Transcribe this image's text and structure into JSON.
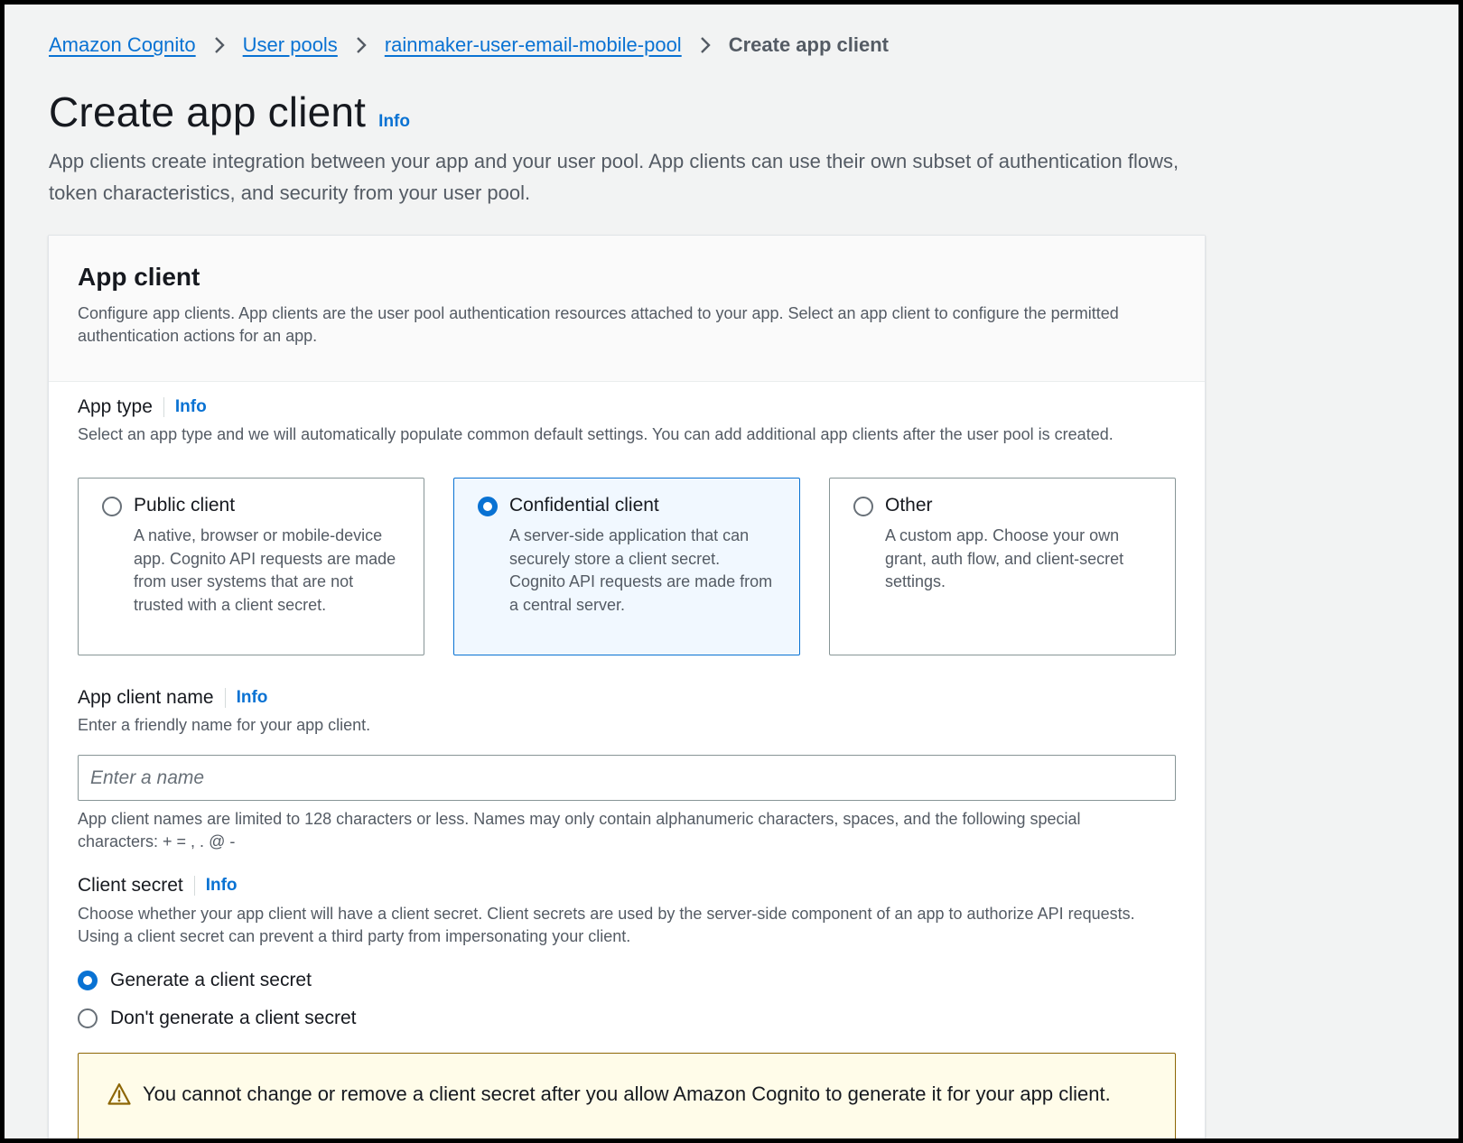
{
  "breadcrumb": {
    "items": [
      "Amazon Cognito",
      "User pools",
      "rainmaker-user-email-mobile-pool"
    ],
    "current": "Create app client"
  },
  "header": {
    "title": "Create app client",
    "info": "Info",
    "description": "App clients create integration between your app and your user pool. App clients can use their own subset of authentication flows, token characteristics, and security from your user pool."
  },
  "container": {
    "title": "App client",
    "description": "Configure app clients. App clients are the user pool authentication resources attached to your app. Select an app client to configure the permitted authentication actions for an app."
  },
  "app_type": {
    "label": "App type",
    "info": "Info",
    "description": "Select an app type and we will automatically populate common default settings. You can add additional app clients after the user pool is created.",
    "selected": "Confidential client",
    "options": [
      {
        "title": "Public client",
        "description": "A native, browser or mobile-device app. Cognito API requests are made from user systems that are not trusted with a client secret."
      },
      {
        "title": "Confidential client",
        "description": "A server-side application that can securely store a client secret. Cognito API requests are made from a central server."
      },
      {
        "title": "Other",
        "description": "A custom app. Choose your own grant, auth flow, and client-secret settings."
      }
    ]
  },
  "app_client_name": {
    "label": "App client name",
    "info": "Info",
    "description": "Enter a friendly name for your app client.",
    "value": "",
    "placeholder": "Enter a name",
    "constraint": "App client names are limited to 128 characters or less. Names may only contain alphanumeric characters, spaces, and the following special characters: + = , . @ -"
  },
  "client_secret": {
    "label": "Client secret",
    "info": "Info",
    "description": "Choose whether your app client will have a client secret. Client secrets are used by the server-side component of an app to authorize API requests. Using a client secret can prevent a third party from impersonating your client.",
    "selected": "Generate a client secret",
    "options": [
      "Generate a client secret",
      "Don't generate a client secret"
    ]
  },
  "alert": {
    "icon": "warning-icon",
    "text": "You cannot change or remove a client secret after you allow Amazon Cognito to generate it for your app client."
  },
  "colors": {
    "link": "#0972d3",
    "selected_tile_bg": "#f1f8ff",
    "warning_bg": "#fffce9",
    "warning_border": "#8d6605"
  }
}
